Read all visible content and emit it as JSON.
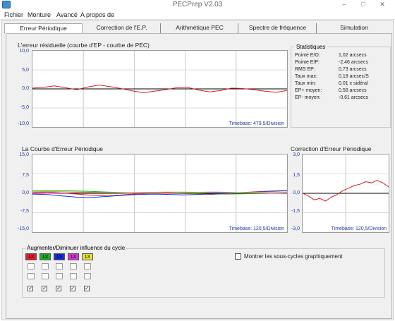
{
  "window": {
    "title": "PECPrep V2.03"
  },
  "menu": [
    "Fichier",
    "Monture",
    "Avancé",
    "A propos de"
  ],
  "tabs": [
    "Erreur Périodique",
    "Correction de l'E.P.",
    "Arithmétique PEC",
    "Spectre de fréquence",
    "Simulation"
  ],
  "active_tab": 0,
  "raw_panel": {
    "title": "L'erreur résiduelle (courbe d'EP - courbe de PEC)",
    "y_ticks": [
      "10,0",
      "5,0",
      "0,0",
      "-5,0",
      "-10,0"
    ],
    "timebase": "Timebase: 479,5/Division"
  },
  "stats": {
    "title": "Statistiques",
    "rows": [
      {
        "label": "Pointe E/O:",
        "value": "1,02 arcsecs"
      },
      {
        "label": "Pointe E/P:",
        "value": "-2,46 arcsecs"
      },
      {
        "label": "RMS EP:",
        "value": "0,73 arcsecs"
      },
      {
        "label": "Taux max:",
        "value": "0,18 arcsec/S"
      },
      {
        "label": "Taux min:",
        "value": "0,01 x sidéral"
      },
      {
        "label": "EP+ moyen:",
        "value": "0,58 arcsecs"
      },
      {
        "label": "EP- moyen:",
        "value": "-0,61 arcsecs"
      }
    ]
  },
  "periodic_panel": {
    "title": "La Courbe d'Erreur Périodique",
    "y_ticks": [
      "15,0",
      "7,5",
      "0,0",
      "-7,5",
      "-15,0"
    ],
    "timebase": "Timebase: 120,5/Division"
  },
  "correction_panel": {
    "title": "Correction d'Erreur Périodique",
    "y_ticks": [
      "3,0",
      "1,5",
      "0,0",
      "-1,5",
      "-3,0"
    ],
    "timebase": "Timebase: 120,5/Division"
  },
  "boost": {
    "title": "Augmenter/Diminuer influence du cycle",
    "cycles": [
      {
        "label": "1X",
        "color": "#e0202a"
      },
      {
        "label": "1X",
        "color": "#1dad2a"
      },
      {
        "label": "1X",
        "color": "#1b2fd0"
      },
      {
        "label": "1X",
        "color": "#d63ad6"
      },
      {
        "label": "1X",
        "color": "#e9e23b"
      }
    ],
    "checkbox_label": "Montrer les sous-cycles graphiquement"
  },
  "chart_data": [
    {
      "type": "line",
      "title": "L'erreur résiduelle (courbe d'EP - courbe de PEC)",
      "ylim": [
        -10,
        10
      ],
      "series": [
        {
          "values": [
            0.2,
            0.4,
            0.8,
            0.3,
            -0.2,
            0.5,
            1.0,
            0.6,
            0.1,
            -0.5,
            -1.0,
            -0.6,
            -0.2,
            0.3,
            0.4,
            -0.3,
            -0.8,
            -0.4,
            0.2,
            0.1,
            -0.2,
            -0.6,
            -0.9,
            -0.4
          ]
        }
      ]
    },
    {
      "type": "line",
      "title": "La Courbe d'Erreur Périodique",
      "ylim": [
        -15,
        15
      ],
      "series": [
        {
          "color": "#d02020",
          "values": [
            0.2,
            0.5,
            0.1,
            -0.3,
            -0.8,
            -1.0,
            -0.6,
            -0.2,
            0.0,
            0.3,
            0.1,
            -0.2,
            -0.4,
            -0.1,
            0.3,
            0.6,
            0.9,
            1.1
          ]
        },
        {
          "color": "#1dad2a",
          "values": [
            1.2,
            1.1,
            1.0,
            0.9,
            0.7,
            0.5,
            0.3,
            0.2,
            0.1,
            0.0,
            -0.1,
            -0.2,
            -0.3,
            -0.3,
            -0.2,
            -0.1,
            0.0,
            0.1
          ]
        },
        {
          "color": "#1b2fd0",
          "values": [
            -0.3,
            -0.5,
            -1.0,
            -1.5,
            -1.6,
            -1.2,
            -0.8,
            -0.5,
            -0.3,
            -0.4,
            -0.6,
            -0.5,
            -0.2,
            0.0,
            0.2,
            0.5,
            0.8,
            1.0
          ]
        },
        {
          "color": "#d63ad6",
          "values": [
            -0.1,
            0.0,
            0.1,
            0.2,
            0.3,
            0.2,
            0.1,
            0.0,
            -0.1,
            0.0,
            0.2,
            0.4,
            0.5,
            0.4,
            0.2,
            0.1,
            0.0,
            -0.1
          ]
        },
        {
          "color": "#b9b227",
          "values": [
            0.6,
            0.7,
            0.6,
            0.5,
            0.4,
            0.3,
            0.2,
            0.3,
            0.4,
            0.5,
            0.5,
            0.4,
            0.3,
            0.2,
            0.3,
            0.4,
            0.5,
            0.5
          ]
        }
      ]
    },
    {
      "type": "line",
      "title": "Correction d'Erreur Périodique",
      "ylim": [
        -3,
        3
      ],
      "series": [
        {
          "color": "#d02020",
          "values": [
            0.0,
            -0.2,
            -0.5,
            -0.4,
            -0.6,
            -0.3,
            -0.1,
            0.2,
            0.4,
            0.6,
            0.7,
            0.9,
            0.8,
            1.0,
            0.8,
            0.5
          ]
        }
      ]
    }
  ]
}
